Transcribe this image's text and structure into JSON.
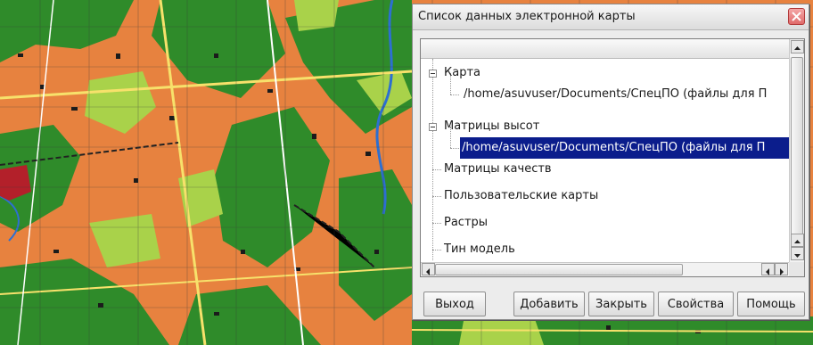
{
  "dialog": {
    "title": "Список данных электронной карты",
    "tree": [
      {
        "label": "Карта",
        "expanded": true
      },
      {
        "label": "/home/asuvuser/Documents/СпецПО (файлы для П"
      },
      {
        "label": "Матрицы высот",
        "expanded": true
      },
      {
        "label": "/home/asuvuser/Documents/СпецПО (файлы для П",
        "selected": true
      },
      {
        "label": "Матрицы качеств"
      },
      {
        "label": "Пользовательские карты"
      },
      {
        "label": "Растры"
      },
      {
        "label": "Тин модель"
      }
    ],
    "buttons": {
      "exit": "Выход",
      "add": "Добавить",
      "close": "Закрыть",
      "properties": "Свойства",
      "help": "Помощь"
    }
  },
  "colors": {
    "map_urban": "#e7823f",
    "map_forest": "#2f8b2a",
    "map_park": "#a9d24a",
    "selection": "#0b1d8c"
  }
}
